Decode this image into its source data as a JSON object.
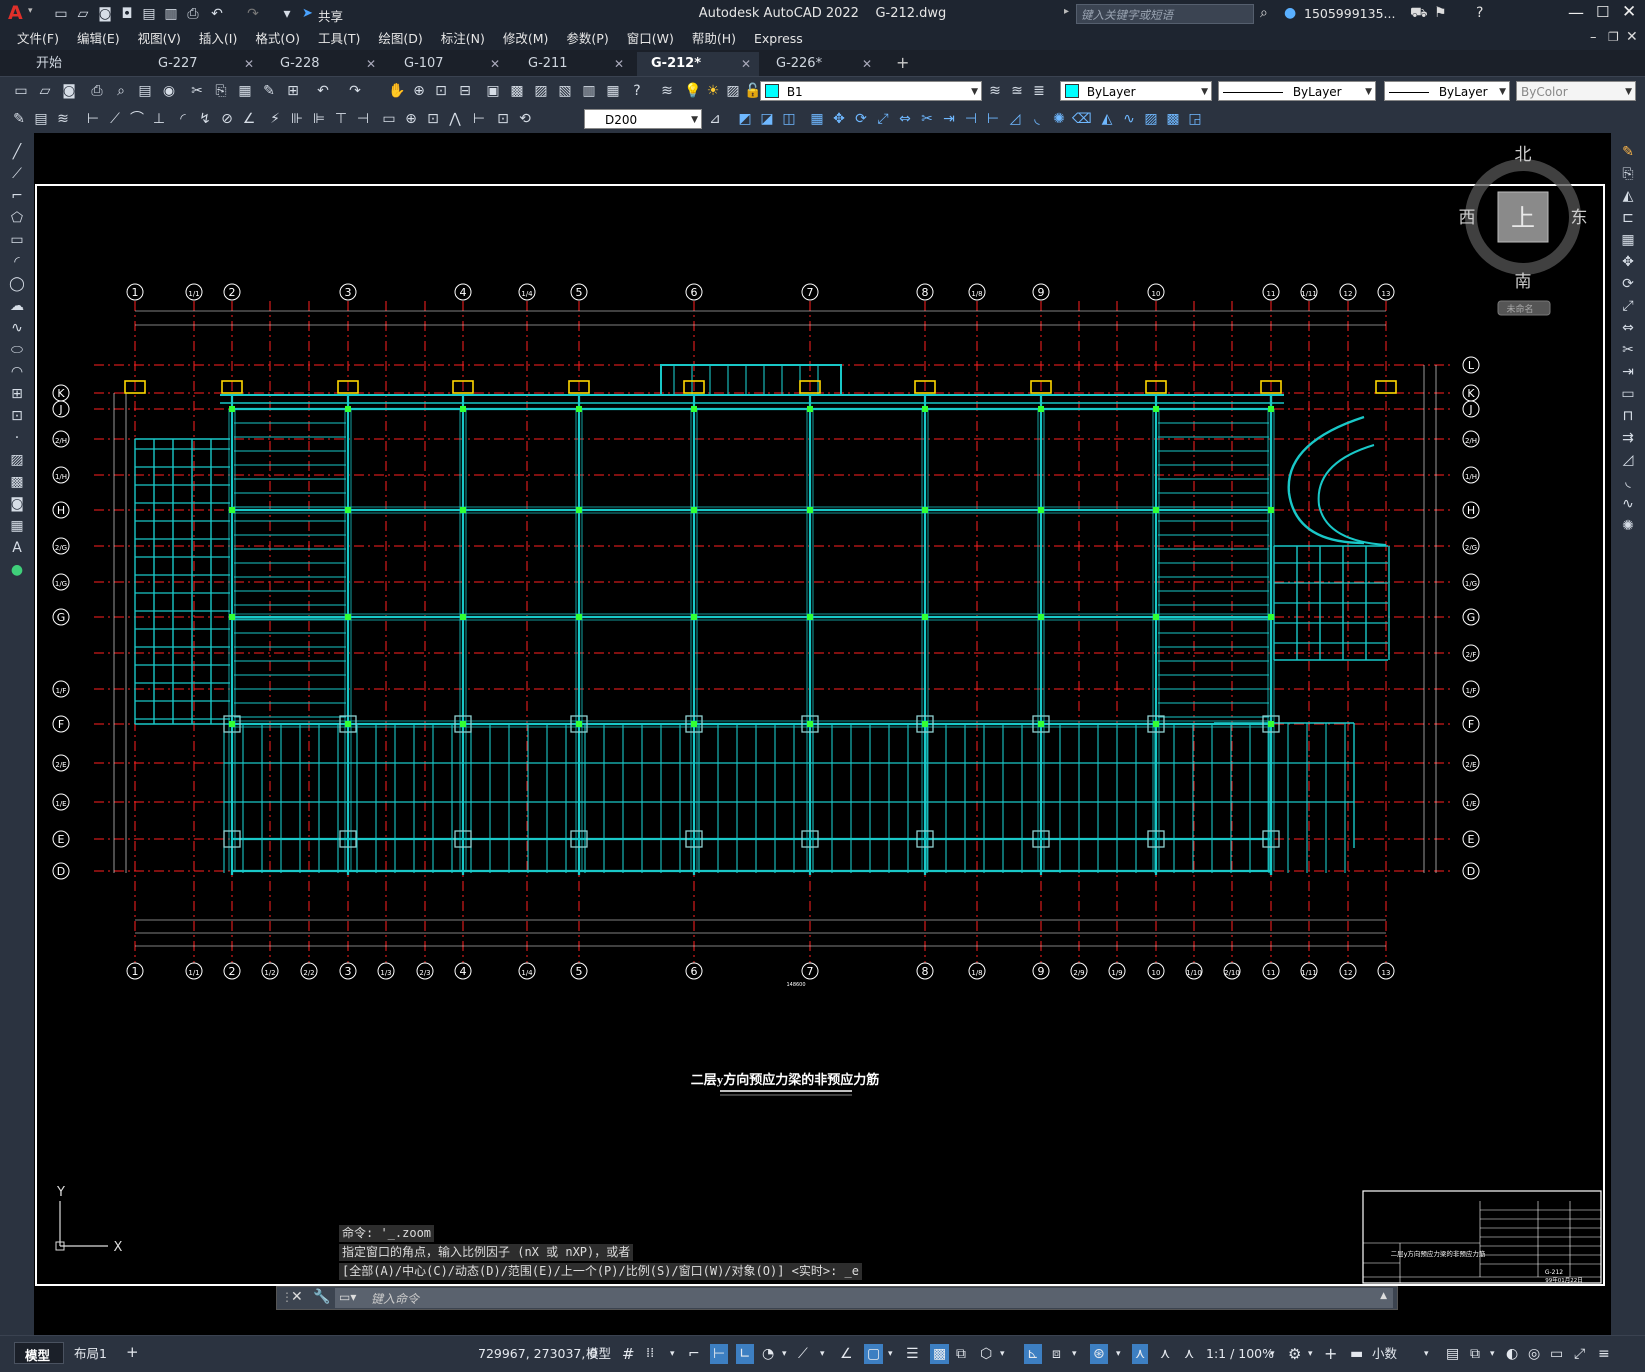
{
  "app": {
    "title": "Autodesk AutoCAD 2022    G-212.dwg",
    "logo": "A",
    "share_label": "共享",
    "search_placeholder": "键入关键字或短语",
    "user": "1505999135...",
    "window_controls": [
      "minimize",
      "maximize",
      "close"
    ]
  },
  "menu": [
    "文件(F)",
    "编辑(E)",
    "视图(V)",
    "插入(I)",
    "格式(O)",
    "工具(T)",
    "绘图(D)",
    "标注(N)",
    "修改(M)",
    "参数(P)",
    "窗口(W)",
    "帮助(H)",
    "Express"
  ],
  "tabs": [
    {
      "label": "开始",
      "active": false
    },
    {
      "label": "G-227",
      "active": false
    },
    {
      "label": "G-228",
      "active": false
    },
    {
      "label": "G-107",
      "active": false
    },
    {
      "label": "G-211",
      "active": false
    },
    {
      "label": "G-212*",
      "active": true
    },
    {
      "label": "G-226*",
      "active": false
    }
  ],
  "toolbar": {
    "layer": "B1",
    "color": "ByLayer",
    "linetype": "ByLayer",
    "lineweight": "ByLayer",
    "plotstyle": "ByColor",
    "dimstyle": "D200"
  },
  "viewcube": {
    "north": "北",
    "south": "南",
    "east": "东",
    "west": "西",
    "top": "上",
    "wcs": "未命名"
  },
  "drawing": {
    "title": "二层y方向预应力梁的非预应力筋",
    "column_axes_top": [
      "1",
      "1/1",
      "2",
      "3",
      "4",
      "1/4",
      "5",
      "6",
      "7",
      "8",
      "1/8",
      "9",
      "10",
      "11",
      "1/11",
      "12",
      "13"
    ],
    "column_axes_bottom": [
      "1",
      "1/1",
      "2",
      "1/2",
      "2/2",
      "3",
      "1/3",
      "2/3",
      "4",
      "1/4",
      "5",
      "6",
      "7",
      "8",
      "1/8",
      "9",
      "2/9",
      "1/9",
      "10",
      "1/10",
      "2/10",
      "11",
      "1/11",
      "12",
      "13"
    ],
    "row_axes_left": [
      "K",
      "J",
      "2/H",
      "1/H",
      "H",
      "2/G",
      "1/G",
      "G",
      "1/F",
      "F",
      "2/E",
      "1/E",
      "E",
      "D"
    ],
    "row_axes_right": [
      "L",
      "K",
      "J",
      "2/H",
      "1/H",
      "H",
      "2/G",
      "1/G",
      "G",
      "2/F",
      "1/F",
      "F",
      "2/E",
      "1/E",
      "E",
      "D"
    ],
    "total_dim": "148600",
    "title_block": {
      "name": "二层y方向预应力梁的非预应力筋",
      "drawing_no": "G-212",
      "date": "99年01月22日"
    }
  },
  "ucs": {
    "y": "Y",
    "x": "X"
  },
  "command": {
    "history": [
      "命令: '_.zoom",
      "指定窗口的角点，输入比例因子 (nX 或 nXP)，或者",
      "[全部(A)/中心(C)/动态(D)/范围(E)/上一个(P)/比例(S)/窗口(W)/对象(O)] <实时>: _e"
    ],
    "placeholder": "键入命令"
  },
  "status": {
    "layout_tabs": [
      "模型",
      "布局1"
    ],
    "coords": "729967, 273037, 0",
    "mode": "模型",
    "scale": "1:1 / 100%",
    "units": "小数"
  },
  "colors": {
    "beam": "#19c8c8",
    "axis": "#ff2020",
    "dim": "#ffffff",
    "node": "#33ff33",
    "column": "#ffd700",
    "ui_bg": "#2b3340"
  }
}
